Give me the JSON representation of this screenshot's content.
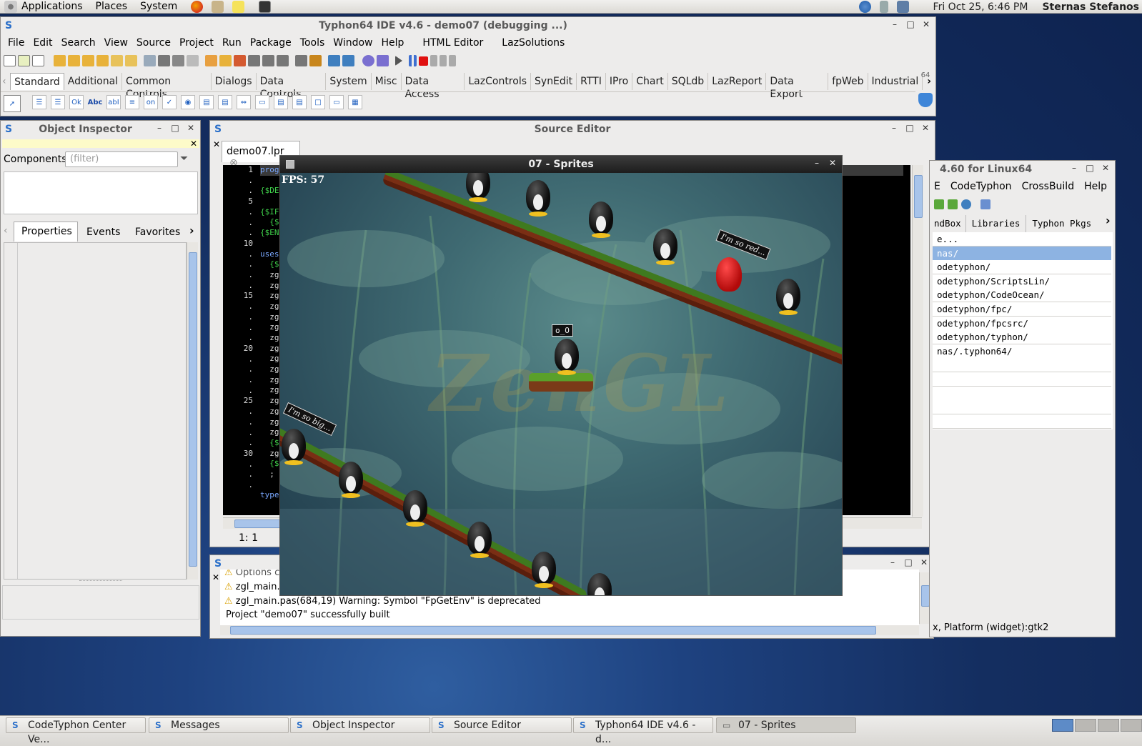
{
  "top_panel": {
    "menus": [
      "Applications",
      "Places",
      "System"
    ],
    "clock": "Fri Oct 25,  6:46 PM",
    "user": "Sternas Stefanos"
  },
  "ide": {
    "title": "Typhon64 IDE v4.6 - demo07 (debugging ...)",
    "menu": [
      "File",
      "Edit",
      "Search",
      "View",
      "Source",
      "Project",
      "Run",
      "Package",
      "Tools",
      "Window",
      "Help",
      "HTML Editor",
      "LazSolutions"
    ],
    "palette_tabs": [
      "Standard",
      "Additional",
      "Common Controls",
      "Dialogs",
      "Data Controls",
      "System",
      "Misc",
      "Data Access",
      "LazControls",
      "SynEdit",
      "RTTI",
      "IPro",
      "Chart",
      "SQLdb",
      "LazReport",
      "Data Export",
      "fpWeb",
      "Industrial"
    ],
    "palette_icon_labels": [
      "Ok",
      "Abc",
      "abI",
      "on"
    ]
  },
  "object_inspector": {
    "title": "Object Inspector",
    "components_label": "Components",
    "filter_placeholder": "(filter)",
    "tabs": [
      "Properties",
      "Events",
      "Favorites"
    ]
  },
  "source_editor": {
    "title": "Source Editor",
    "file_tab": "demo07.lpr",
    "line_numbers": [
      "1",
      ".",
      ".",
      "5",
      ".",
      ".",
      ".",
      "10",
      ".",
      ".",
      ".",
      ".",
      "15",
      ".",
      ".",
      ".",
      ".",
      "20",
      ".",
      ".",
      ".",
      ".",
      "25",
      ".",
      ".",
      ".",
      ".",
      "30",
      ".",
      ".",
      "."
    ],
    "code_lines": [
      "prog",
      "",
      "{$DE",
      "",
      "{$IF",
      "  {$",
      "{$EN",
      "",
      "uses",
      "  {$",
      "  zg",
      "  zg",
      "  zg",
      "  zg",
      "  zg",
      "  zg",
      "  zg",
      "  zg",
      "  zg",
      "  zg",
      "  zg",
      "  zg",
      "  zg",
      "  zg",
      "  zg",
      "  zg",
      "  {$",
      "  zg",
      "  {$",
      "  ;",
      "",
      "type"
    ],
    "status": "1:  1"
  },
  "messages": {
    "lines": [
      {
        "icon": "warning-icon",
        "text": "Options cha"
      },
      {
        "icon": "warning-icon",
        "text": "zgl_main."
      },
      {
        "icon": "warning-icon",
        "text": "zgl_main.pas(684,19) Warning: Symbol \"FpGetEnv\" is deprecated"
      },
      {
        "icon": "",
        "text": "Project \"demo07\" successfully built"
      }
    ]
  },
  "sprites": {
    "title": "07 - Sprites",
    "fps": "FPS: 57",
    "logo_text": "ZenGL",
    "bubble_red": "I'm so red...",
    "bubble_big": "I'm so big...",
    "bubble_face": "o_O",
    "colors": {
      "sky": "#4a6f84",
      "branch_grass": "#3f7a1f",
      "branch_wood": "#7a2e14",
      "red_penguin": "#d21c1c"
    }
  },
  "codetyphon_center": {
    "title": "4.60 for Linux64",
    "menu": [
      "E",
      "CodeTyphon",
      "CrossBuild",
      "Help"
    ],
    "tabs": [
      "ndBox",
      "Libraries",
      "Typhon Pkgs"
    ],
    "list": [
      "e...",
      "nas/",
      "odetyphon/",
      "odetyphon/ScriptsLin/",
      "odetyphon/CodeOcean/",
      "odetyphon/fpc/",
      "odetyphon/fpcsrc/",
      "odetyphon/typhon/",
      "nas/.typhon64/"
    ],
    "status": "x, Platform (widget):gtk2"
  },
  "taskbar": {
    "tasks": [
      "CodeTyphon Center Ve...",
      "Messages",
      "Object Inspector",
      "Source Editor",
      "Typhon64 IDE v4.6 - d...",
      "07 - Sprites"
    ]
  }
}
